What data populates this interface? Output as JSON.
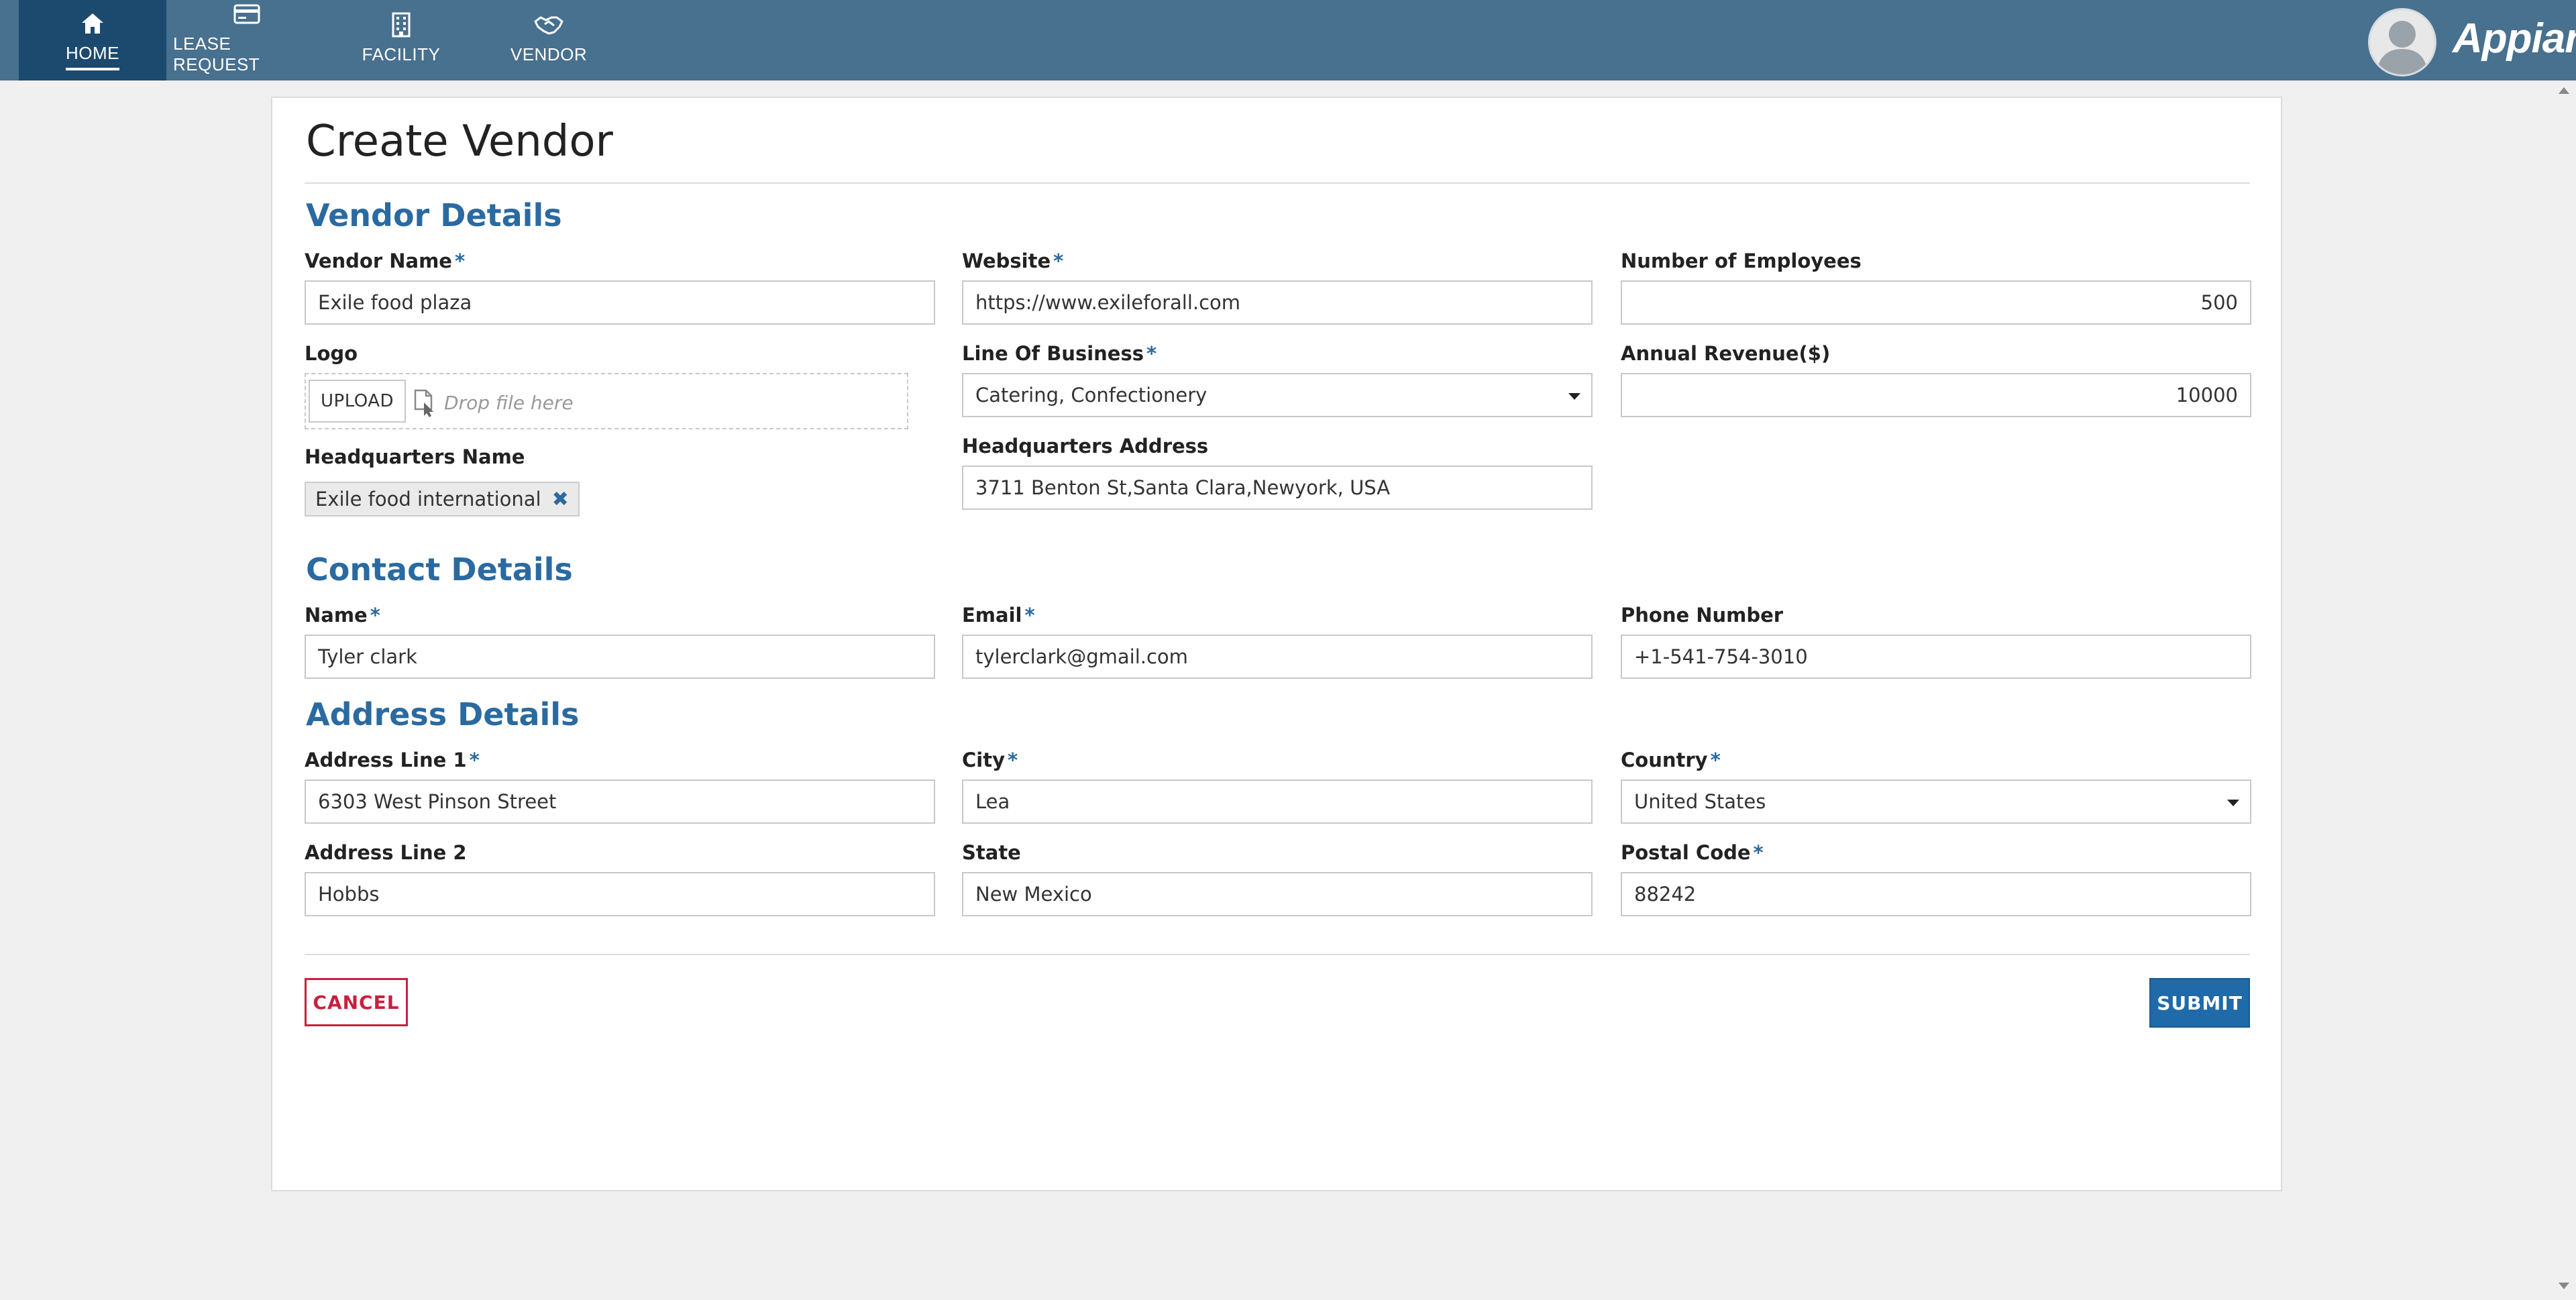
{
  "nav": {
    "items": [
      {
        "label": "HOME",
        "icon": "home-icon",
        "active": true
      },
      {
        "label": "LEASE REQUEST",
        "icon": "card-icon",
        "active": false
      },
      {
        "label": "FACILITY",
        "icon": "building-icon",
        "active": false
      },
      {
        "label": "VENDOR",
        "icon": "handshake-icon",
        "active": false
      }
    ],
    "brand": "Appian"
  },
  "form": {
    "title": "Create Vendor",
    "sections": {
      "vendor": "Vendor Details",
      "contact": "Contact Details",
      "address": "Address Details"
    },
    "vendor": {
      "vendor_name": {
        "label": "Vendor Name",
        "required": true,
        "value": "Exile food plaza"
      },
      "website": {
        "label": "Website",
        "required": true,
        "value": "https://www.exileforall.com"
      },
      "employees": {
        "label": "Number of Employees",
        "required": false,
        "value": "500"
      },
      "logo": {
        "label": "Logo",
        "upload_label": "UPLOAD",
        "drop_text": "Drop file here"
      },
      "line_of_business": {
        "label": "Line Of Business",
        "required": true,
        "value": "Catering, Confectionery"
      },
      "annual_revenue": {
        "label": "Annual Revenue($)",
        "required": false,
        "value": "10000"
      },
      "hq_name": {
        "label": "Headquarters Name",
        "required": false,
        "value": "Exile food international"
      },
      "hq_address": {
        "label": "Headquarters Address",
        "required": false,
        "value": "3711 Benton St,Santa Clara,Newyork, USA"
      }
    },
    "contact": {
      "name": {
        "label": "Name",
        "required": true,
        "value": "Tyler clark"
      },
      "email": {
        "label": "Email",
        "required": true,
        "value": "tylerclark@gmail.com"
      },
      "phone": {
        "label": "Phone Number",
        "required": false,
        "value": "+1-541-754-3010"
      }
    },
    "address": {
      "line1": {
        "label": "Address Line 1",
        "required": true,
        "value": "6303 West Pinson Street"
      },
      "city": {
        "label": "City",
        "required": true,
        "value": "Lea"
      },
      "country": {
        "label": "Country",
        "required": true,
        "value": "United States"
      },
      "line2": {
        "label": "Address Line 2",
        "required": false,
        "value": "Hobbs"
      },
      "state": {
        "label": "State",
        "required": false,
        "value": "New Mexico"
      },
      "postal": {
        "label": "Postal Code",
        "required": true,
        "value": "88242"
      }
    },
    "buttons": {
      "cancel": "CANCEL",
      "submit": "SUBMIT"
    },
    "required_marker": "*"
  },
  "colors": {
    "nav_bg": "#48708f",
    "nav_active_bg": "#1c4a6e",
    "section_title": "#2a6aa0",
    "cancel": "#c8203f",
    "submit": "#1f6aa8"
  }
}
